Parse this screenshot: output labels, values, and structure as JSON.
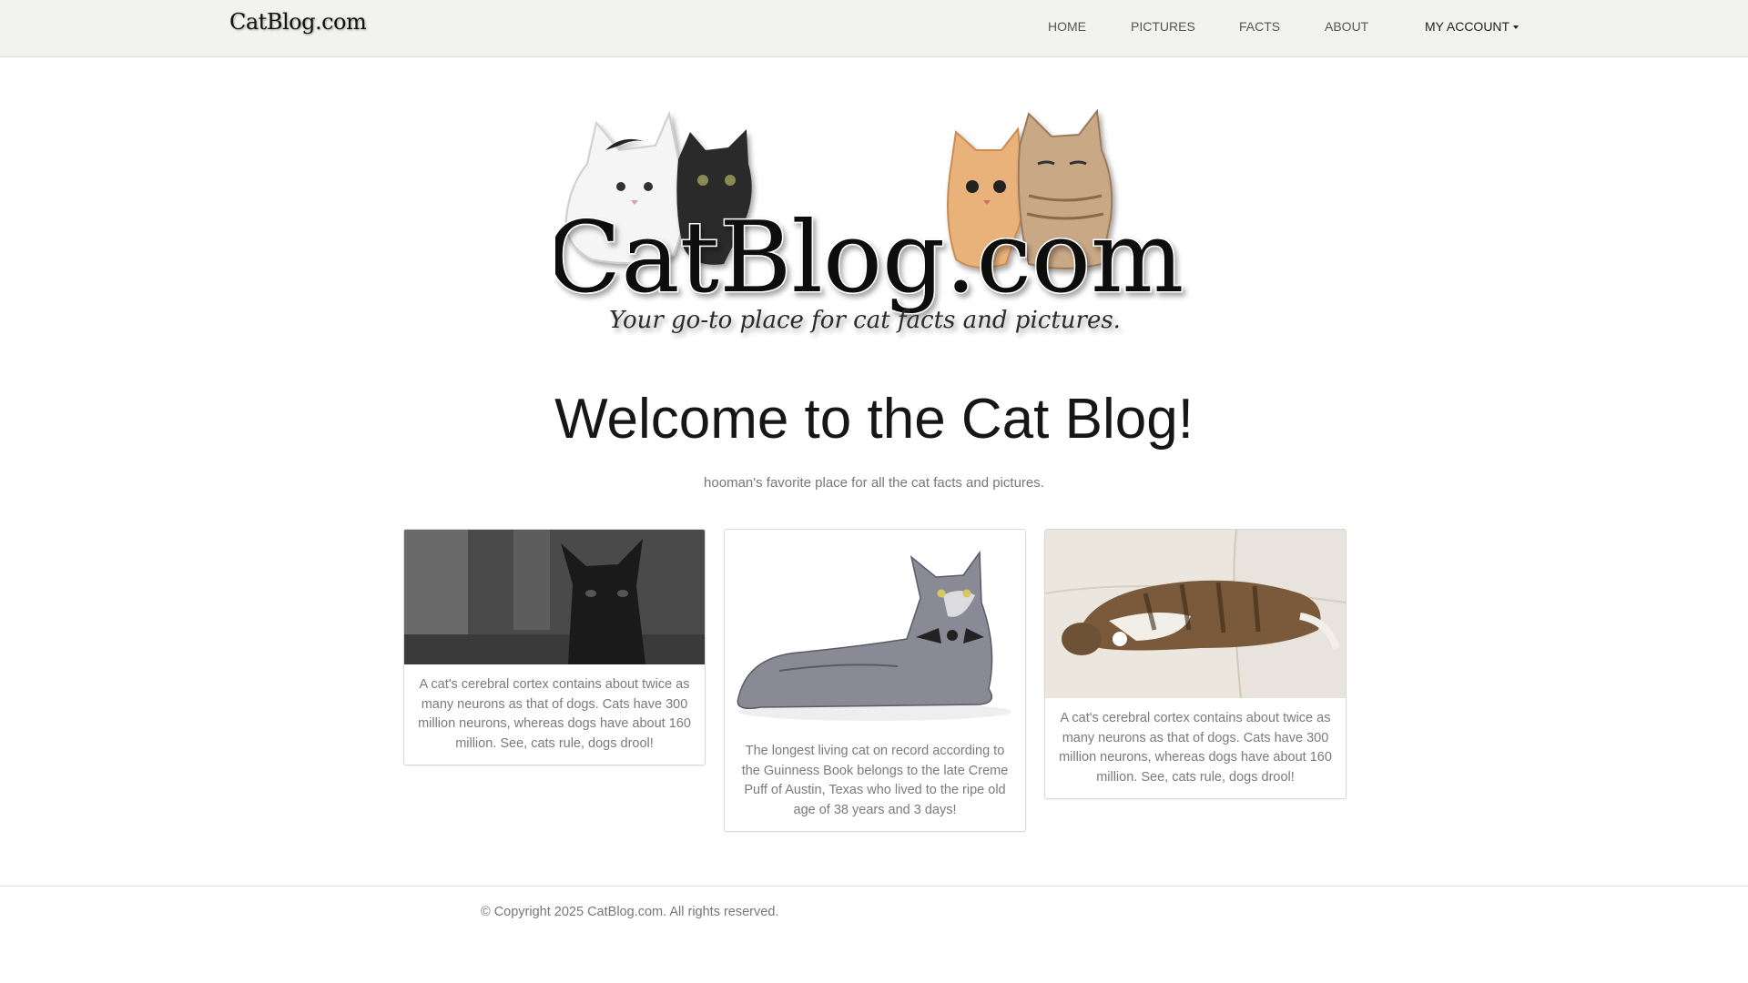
{
  "brand": {
    "text": "CatBlog.com"
  },
  "nav": {
    "items": [
      {
        "label": "HOME"
      },
      {
        "label": "PICTURES"
      },
      {
        "label": "FACTS"
      },
      {
        "label": "ABOUT"
      }
    ],
    "account": {
      "label": "MY ACCOUNT"
    }
  },
  "hero": {
    "logo_text": "CatBlog.com",
    "tagline": "Your go-to place for cat facts and pictures."
  },
  "main": {
    "title": "Welcome to the Cat Blog!",
    "subtitle": "hooman's favorite place for all the cat facts and pictures."
  },
  "cards": [
    {
      "text": "A cat's cerebral cortex contains about twice as many neurons as that of dogs. Cats have 300 million neurons, whereas dogs have about 160 million. See, cats rule, dogs drool!"
    },
    {
      "text": "The longest living cat on record according to the Guinness Book belongs to the late Creme Puff of Austin, Texas who lived to the ripe old age of 38 years and 3 days!"
    },
    {
      "text": "A cat's cerebral cortex contains about twice as many neurons as that of dogs. Cats have 300 million neurons, whereas dogs have about 160 million. See, cats rule, dogs drool!"
    }
  ],
  "footer": {
    "copyright": "© Copyright 2025 CatBlog.com. All rights reserved."
  },
  "colors": {
    "navbar_bg": "#f2f2f0",
    "text_dark": "#161616",
    "text_muted": "#777777",
    "border": "#d8d8d8"
  }
}
